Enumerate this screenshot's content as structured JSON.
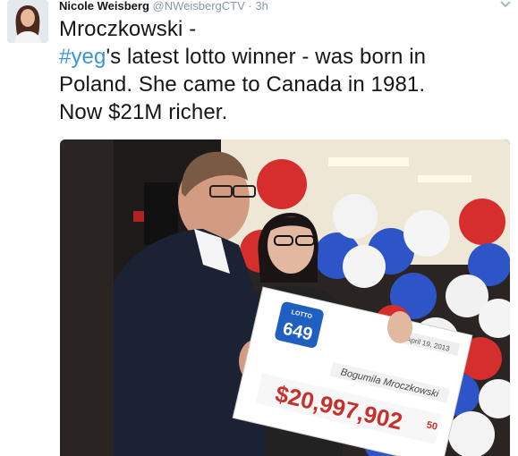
{
  "tweet": {
    "author_name": "Nicole Weisberg",
    "author_handle": "@NWeisbergCTV",
    "separator": "·",
    "timestamp": "3h",
    "text_line1": "Mroczkowski -",
    "hashtag": "#yeg",
    "text_line2_rest": "'s latest lotto winner - was born in",
    "text_line3": "Poland. She came to Canada in 1981.",
    "text_line4": "Now $21M richer."
  },
  "photo": {
    "cheque_logo_top": "LOTTO",
    "cheque_logo_number": "649",
    "cheque_date": "April 19, 2013",
    "cheque_payee": "Bogumila Mroczkowski",
    "cheque_amount": "$20,997,902",
    "cheque_cents": "50"
  },
  "colors": {
    "hashtag": "#3b94d9",
    "name": "#14171a",
    "meta": "#8899a6"
  },
  "icons": {
    "menu": "chevron-down-icon"
  }
}
